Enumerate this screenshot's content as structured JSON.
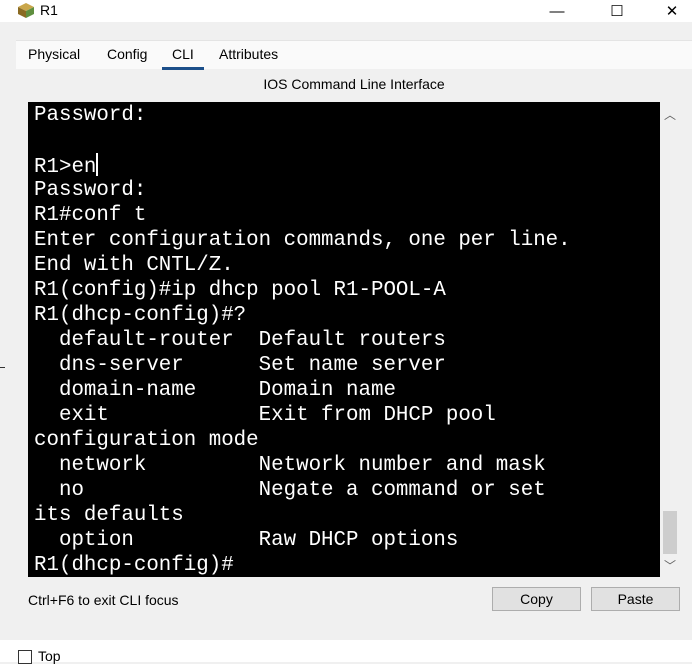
{
  "window": {
    "title": "R1",
    "minimize_glyph": "—",
    "maximize_glyph": "☐",
    "close_glyph": "✕",
    "icon": "router-app-icon"
  },
  "tabs": [
    {
      "label": "Physical",
      "active": false
    },
    {
      "label": "Config",
      "active": false
    },
    {
      "label": "CLI",
      "active": true
    },
    {
      "label": "Attributes",
      "active": false
    }
  ],
  "cli": {
    "heading": "IOS Command Line Interface",
    "lines": [
      "Password:",
      "",
      "R1>en",
      "Password:",
      "R1#conf t",
      "Enter configuration commands, one per line.",
      "End with CNTL/Z.",
      "R1(config)#ip dhcp pool R1-POOL-A",
      "R1(dhcp-config)#?",
      "  default-router  Default routers",
      "  dns-server      Set name server",
      "  domain-name     Domain name",
      "  exit            Exit from DHCP pool",
      "configuration mode",
      "  network         Network number and mask",
      "  no              Negate a command or set",
      "its defaults",
      "  option          Raw DHCP options",
      "R1(dhcp-config)#"
    ]
  },
  "scrollbar": {
    "up_glyph": "︿",
    "down_glyph": "﹀"
  },
  "bottom": {
    "hint": "Ctrl+F6 to exit CLI focus",
    "copy_label": "Copy",
    "paste_label": "Paste"
  },
  "footer": {
    "top_label": "Top",
    "top_checked": false
  }
}
